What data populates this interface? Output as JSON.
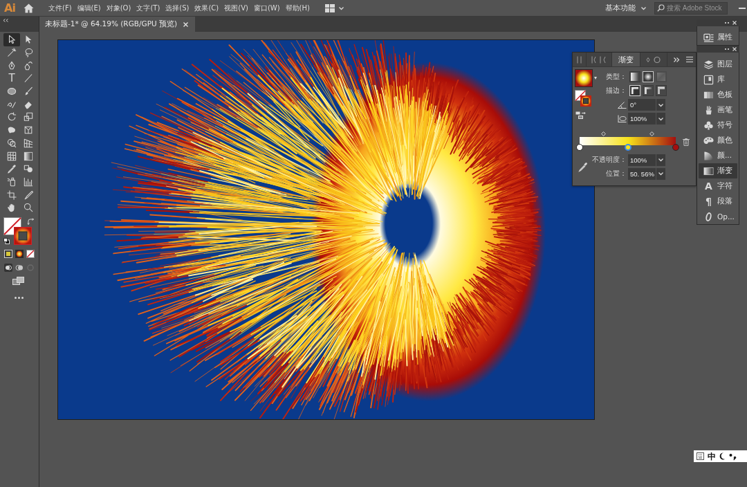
{
  "app": {
    "logo": "Ai"
  },
  "menu": [
    "文件(F)",
    "编辑(E)",
    "对象(O)",
    "文字(T)",
    "选择(S)",
    "效果(C)",
    "视图(V)",
    "窗口(W)",
    "帮助(H)"
  ],
  "workspace": {
    "label": "基本功能"
  },
  "search": {
    "placeholder": "搜索 Adobe Stock"
  },
  "document_tab": {
    "title": "未标题-1* @ 64.19% (RGB/GPU 预览)"
  },
  "tools": [
    {
      "selected": true
    },
    {
      "selected": false
    },
    {
      "selected": false
    },
    {
      "selected": false
    },
    {
      "selected": false
    },
    {
      "selected": false
    },
    {
      "selected": false,
      "glyph": "T"
    },
    {
      "selected": false
    },
    {
      "selected": false
    },
    {
      "selected": false
    },
    {
      "selected": false
    },
    {
      "selected": false
    },
    {
      "selected": false
    },
    {
      "selected": false
    },
    {
      "selected": false
    },
    {
      "selected": false
    },
    {
      "selected": false
    },
    {
      "selected": false
    },
    {
      "selected": false
    },
    {
      "selected": false
    },
    {
      "selected": false
    },
    {
      "selected": false
    },
    {
      "selected": false
    },
    {
      "selected": false
    },
    {
      "selected": false
    },
    {
      "selected": false
    },
    {
      "selected": false
    },
    {
      "selected": false
    }
  ],
  "gradient_panel": {
    "tabs": [
      {
        "selected": false
      },
      {
        "selected": false
      },
      {
        "label": "渐变",
        "selected": true
      },
      {
        "selected": false
      }
    ],
    "type_label": "类型：",
    "type_options": [
      {
        "selected": false,
        "disabled": false
      },
      {
        "selected": true,
        "disabled": false
      },
      {
        "selected": false,
        "disabled": true
      }
    ],
    "stroke_label": "描边：",
    "stroke_options": [
      {
        "selected": true
      },
      {
        "selected": false
      },
      {
        "selected": false
      }
    ],
    "angle": "0°",
    "aspect_ratio": "100%",
    "stops": [
      {
        "color": "#ffffff",
        "level": 0,
        "selected": false
      },
      {
        "color": "#f7e21b",
        "level": 0.5056,
        "selected": true
      },
      {
        "color": "#a30f0f",
        "level": 1,
        "selected": false
      }
    ],
    "midpoints": [
      {
        "level": 0.25
      },
      {
        "level": 0.75
      }
    ],
    "opacity_label": "不透明度：",
    "opacity": "100%",
    "location_label": "位置：",
    "location": "50. 56%"
  },
  "dock": {
    "top_items": [
      {
        "label": "属性",
        "selected": false
      }
    ],
    "items": [
      {
        "label": "图层",
        "selected": false
      },
      {
        "label": "库",
        "selected": false
      },
      {
        "label": "色板",
        "selected": false
      },
      {
        "label": "画笔",
        "selected": false
      },
      {
        "label": "符号",
        "selected": false
      },
      {
        "label": "颜色",
        "selected": false
      },
      {
        "label": "颜...",
        "selected": false
      },
      {
        "label": "渐变",
        "selected": true
      },
      {
        "label": "字符",
        "glyph": "A",
        "selected": false
      },
      {
        "label": "段落",
        "glyph": "¶",
        "selected": false
      },
      {
        "label": "Op...",
        "selected": false
      }
    ]
  },
  "ime_bar": {
    "mode": "中"
  }
}
